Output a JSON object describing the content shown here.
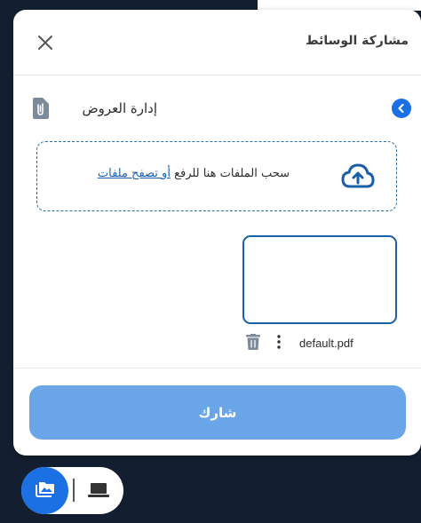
{
  "dialog": {
    "title": "مشاركة الوسائط",
    "section_title": "إدارة العروض"
  },
  "dropzone": {
    "text": "سحب الملفات هنا للرفع ",
    "link": "أو تصفح ملفات"
  },
  "file": {
    "name": "default.pdf"
  },
  "share_button": {
    "label": "شارك"
  },
  "icons": {
    "close": "close-icon",
    "back": "chevron-left-icon",
    "section": "file-attachment-icon",
    "upload": "cloud-upload-icon",
    "trash": "trash-icon",
    "more": "more-vertical-icon",
    "media": "media-folder-icon",
    "screen": "laptop-icon"
  },
  "colors": {
    "accent": "#1b70e3",
    "share_button": "#6aa6e7",
    "background": "#131f30"
  }
}
